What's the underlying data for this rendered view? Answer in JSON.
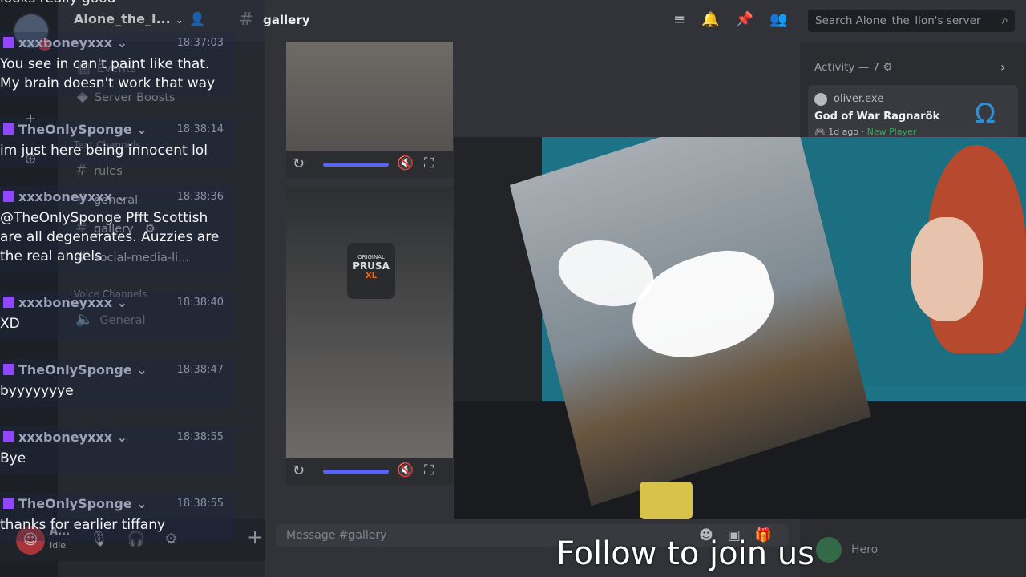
{
  "server": {
    "name": "Alone_the_l...",
    "notification_count": "1"
  },
  "channel": {
    "name": "gallery"
  },
  "search": {
    "placeholder": "Search Alone_the_lion's server"
  },
  "sidebar": {
    "events_label": "Events",
    "boosts_label": "Server Boosts",
    "text_category": "Text Channels",
    "channels": [
      "rules",
      "general",
      "gallery",
      "social-media-li..."
    ],
    "voice_category": "Voice Channels",
    "voice_channels": [
      "General"
    ]
  },
  "user_panel": {
    "name": "A...",
    "status": "Idle"
  },
  "composer": {
    "placeholder": "Message #gallery"
  },
  "activity": {
    "header": "Activity — 7",
    "card": {
      "user": "oliver.exe",
      "game": "God of War Ragnarök",
      "time": "1d ago",
      "badge": "New Player"
    }
  },
  "member": {
    "name": "Hero"
  },
  "media": {
    "player1": {
      "progress": 1.0
    },
    "player2": {
      "progress": 1.0,
      "brand_line1": "ORIGINAL",
      "brand_line2": "PRUSA",
      "brand_line3": "XL"
    }
  },
  "chat": {
    "top_fragment": "looks really good",
    "messages": [
      {
        "author": "xxxboneyxxx",
        "time": "18:37:03",
        "lines": [
          "You see in can't paint like that.",
          "My brain doesn't work that way"
        ]
      },
      {
        "author": "TheOnlySponge",
        "time": "18:38:14",
        "lines": [
          "im just here being innocent lol"
        ]
      },
      {
        "author": "xxxboneyxxx",
        "time": "18:38:36",
        "lines": [
          "@TheOnlySponge Pfft Scottish",
          "are all degenerates. Auzzies are",
          "the real angels"
        ]
      },
      {
        "author": "xxxboneyxxx",
        "time": "18:38:40",
        "lines": [
          "XD"
        ]
      },
      {
        "author": "TheOnlySponge",
        "time": "18:38:47",
        "lines": [
          "byyyyyyye"
        ]
      },
      {
        "author": "xxxboneyxxx",
        "time": "18:38:55",
        "lines": [
          "Bye"
        ]
      },
      {
        "author": "TheOnlySponge",
        "time": "18:38:55",
        "lines": [
          "thanks for earlier tiffany"
        ]
      }
    ]
  },
  "overlay": {
    "follow_text": "Follow to join us"
  },
  "colors": {
    "accent": "#5865f2",
    "twitch": "#9146ff",
    "background": "#313338"
  }
}
